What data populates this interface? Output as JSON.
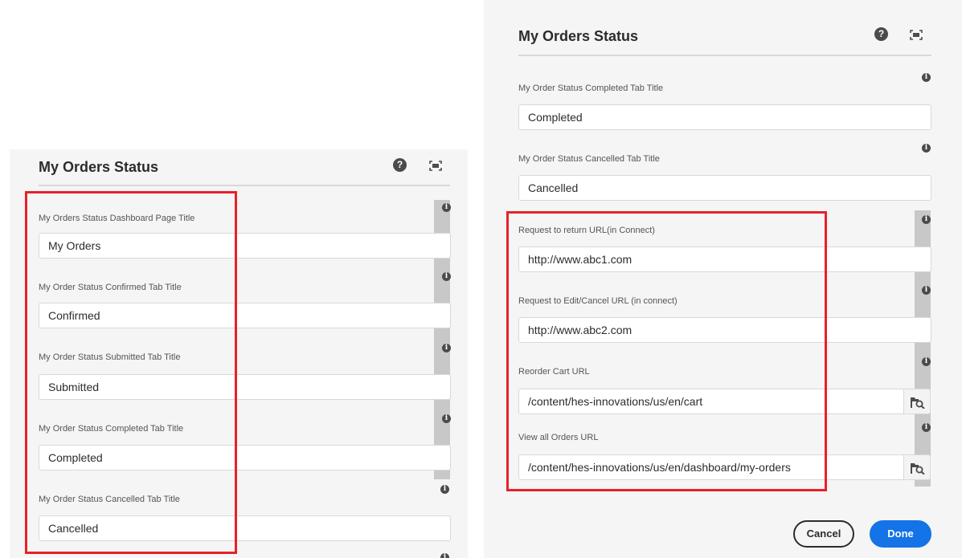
{
  "left_dialog": {
    "title": "My Orders Status",
    "help_icon": "?",
    "fields": [
      {
        "label": "My Orders Status Dashboard Page Title",
        "value": "My Orders"
      },
      {
        "label": "My Order Status Confirmed Tab Title",
        "value": "Confirmed"
      },
      {
        "label": "My Order Status Submitted Tab Title",
        "value": "Submitted"
      },
      {
        "label": "My Order Status Completed Tab Title",
        "value": "Completed"
      },
      {
        "label": "My Order Status Cancelled Tab Title",
        "value": "Cancelled"
      }
    ]
  },
  "right_dialog": {
    "title": "My Orders Status",
    "help_icon": "?",
    "fields": [
      {
        "label": "My Order Status Completed Tab Title",
        "value": "Completed"
      },
      {
        "label": "My Order Status Cancelled Tab Title",
        "value": "Cancelled"
      },
      {
        "label": "Request to return URL(in Connect)",
        "value": "http://www.abc1.com"
      },
      {
        "label": "Request to Edit/Cancel URL (in connect)",
        "value": "http://www.abc2.com"
      },
      {
        "label": "Reorder Cart URL",
        "value": "/content/hes-innovations/us/en/cart"
      },
      {
        "label": "View all Orders URL",
        "value": "/content/hes-innovations/us/en/dashboard/my-orders"
      }
    ],
    "cancel_label": "Cancel",
    "done_label": "Done"
  },
  "icons": {
    "help": "help-icon",
    "fullscreen": "fullscreen-icon",
    "info": "info-icon",
    "browse": "browse-path-icon"
  },
  "info_glyph": "i",
  "colors": {
    "highlight": "#e8202a",
    "primary_button": "#1473e6",
    "dialog_bg": "#f5f5f5"
  }
}
